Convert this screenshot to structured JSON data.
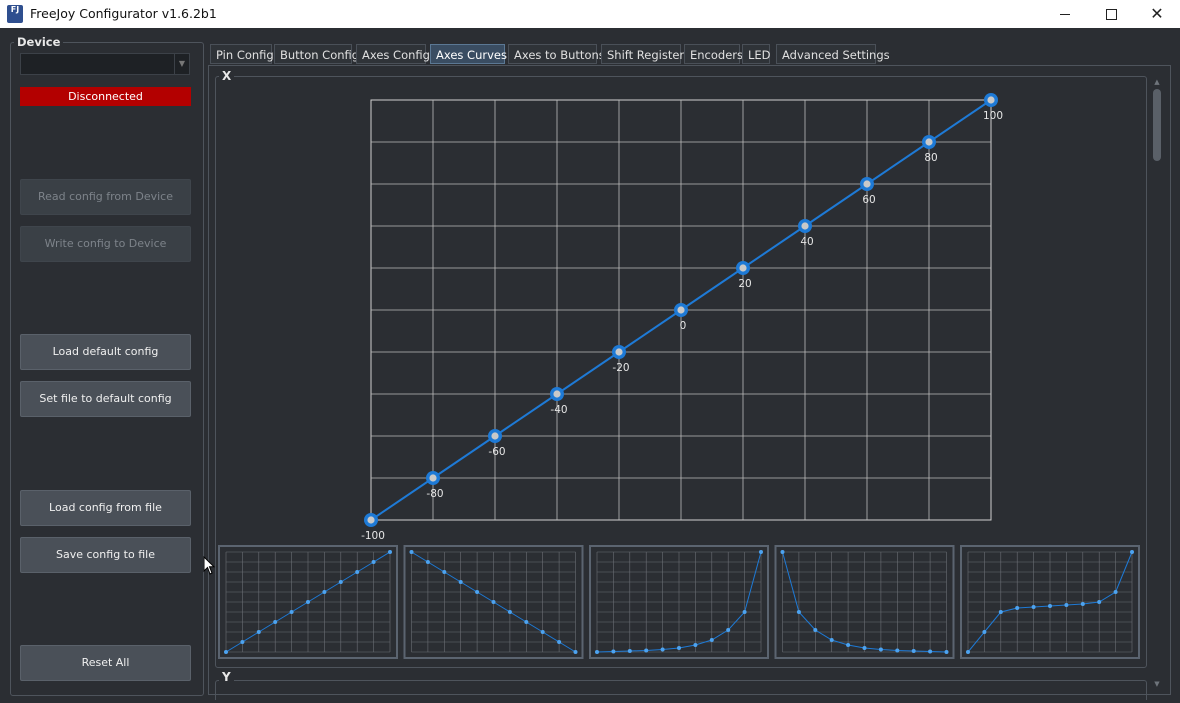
{
  "window": {
    "title": "FreeJoy Configurator v1.6.2b1",
    "icon_text": "FJ"
  },
  "device": {
    "group_title": "Device",
    "selected": "",
    "status": "Disconnected",
    "status_color": "#b30000",
    "buttons": {
      "read": "Read config from Device",
      "write": "Write config to Device",
      "load_default": "Load default config",
      "set_default": "Set file to default config",
      "load_file": "Load config from file",
      "save_file": "Save config to file",
      "reset": "Reset All"
    }
  },
  "tabs": [
    {
      "label": "Pin Config",
      "active": false
    },
    {
      "label": "Button Config",
      "active": false
    },
    {
      "label": "Axes Config",
      "active": false
    },
    {
      "label": "Axes Curves",
      "active": true
    },
    {
      "label": "Axes to Buttons",
      "active": false
    },
    {
      "label": "Shift Registers",
      "active": false
    },
    {
      "label": "Encoders",
      "active": false
    },
    {
      "label": "LED",
      "active": false
    },
    {
      "label": "Advanced Settings",
      "active": false
    }
  ],
  "groups": {
    "x_label": "X",
    "y_label": "Y"
  },
  "colors": {
    "accent": "#1e7ad6",
    "background": "#2b2e33"
  },
  "chart_data": {
    "type": "line",
    "x": [
      0,
      1,
      2,
      3,
      4,
      5,
      6,
      7,
      8,
      9,
      10
    ],
    "series": [
      {
        "values": [
          -100,
          -80,
          -60,
          -40,
          -20,
          0,
          20,
          40,
          60,
          80,
          100
        ]
      }
    ],
    "point_labels": [
      "-100",
      "-80",
      "-60",
      "-40",
      "-20",
      "0",
      "20",
      "40",
      "60",
      "80",
      "100"
    ],
    "ylim": [
      -100,
      100
    ],
    "grid": true
  },
  "presets": [
    {
      "values": [
        0,
        10,
        20,
        30,
        40,
        50,
        60,
        70,
        80,
        90,
        100
      ]
    },
    {
      "values": [
        100,
        90,
        80,
        70,
        60,
        50,
        40,
        30,
        20,
        10,
        0
      ]
    },
    {
      "values": [
        0,
        0.5,
        1,
        1.5,
        2.5,
        4,
        7,
        12,
        22,
        40,
        100
      ]
    },
    {
      "values": [
        100,
        40,
        22,
        12,
        7,
        4,
        2.5,
        1.5,
        1,
        0.5,
        0
      ]
    },
    {
      "values": [
        0,
        20,
        40,
        44,
        45,
        46,
        47,
        48,
        50,
        60,
        100
      ]
    }
  ]
}
